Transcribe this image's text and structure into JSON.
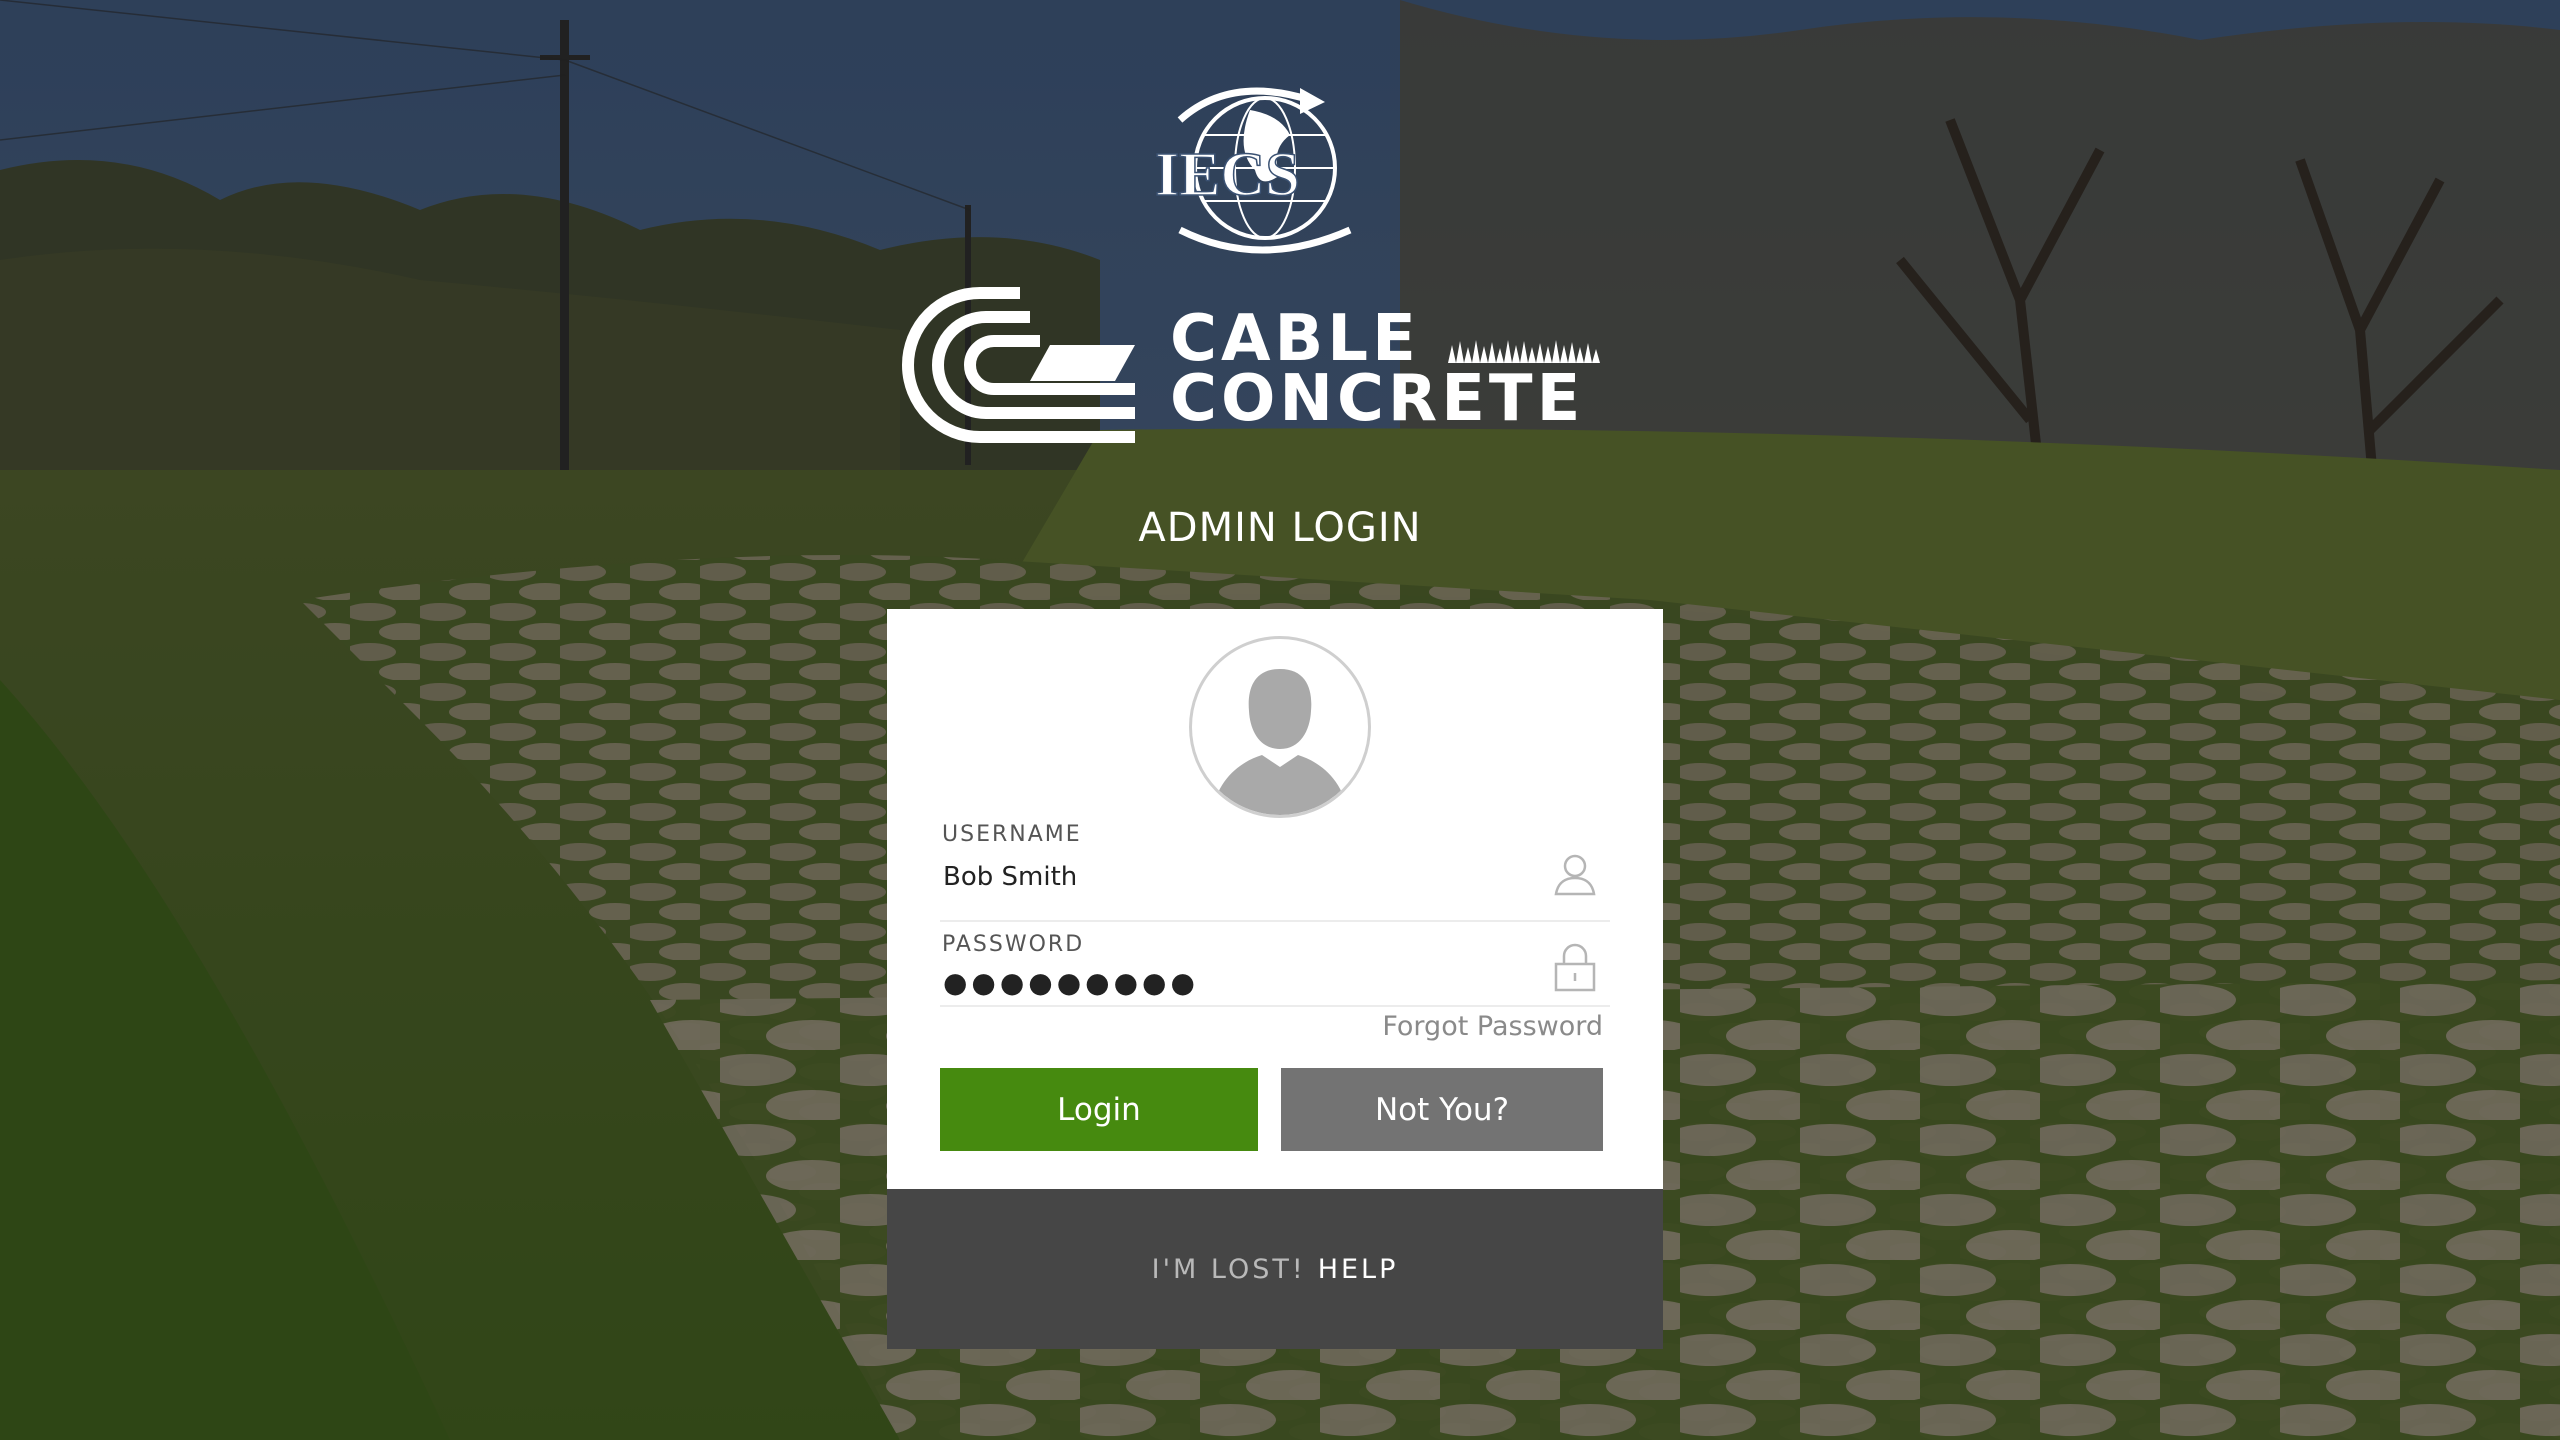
{
  "page": {
    "title": "ADMIN LOGIN"
  },
  "brand": {
    "iecs_logo_text": "IECS",
    "company_line1": "CABLE",
    "company_line2": "CONCRETE"
  },
  "login_form": {
    "username_label": "USERNAME",
    "username_value": "Bob Smith",
    "password_label": "PASSWORD",
    "password_value": "●●●●●●●●●",
    "forgot_password": "Forgot Password",
    "login_button": "Login",
    "not_you_button": "Not You?"
  },
  "help": {
    "lost_text": "I'M LOST!",
    "help_link": "HELP"
  },
  "icons": {
    "avatar": "user-silhouette-icon",
    "username": "user-icon",
    "password": "lock-icon"
  },
  "colors": {
    "login_button": "#468a0f",
    "not_you_button": "#737373",
    "help_bar": "#464646",
    "card": "#ffffff"
  }
}
